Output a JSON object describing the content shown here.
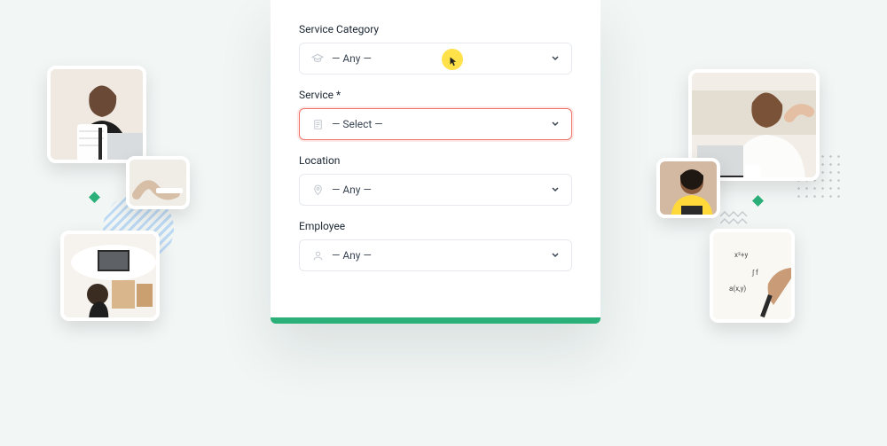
{
  "form": {
    "serviceCategory": {
      "label": "Service Category",
      "value": "— Any —"
    },
    "service": {
      "label": "Service *",
      "value": "— Select —"
    },
    "location": {
      "label": "Location",
      "value": "— Any —"
    },
    "employee": {
      "label": "Employee",
      "value": "— Any —"
    }
  }
}
